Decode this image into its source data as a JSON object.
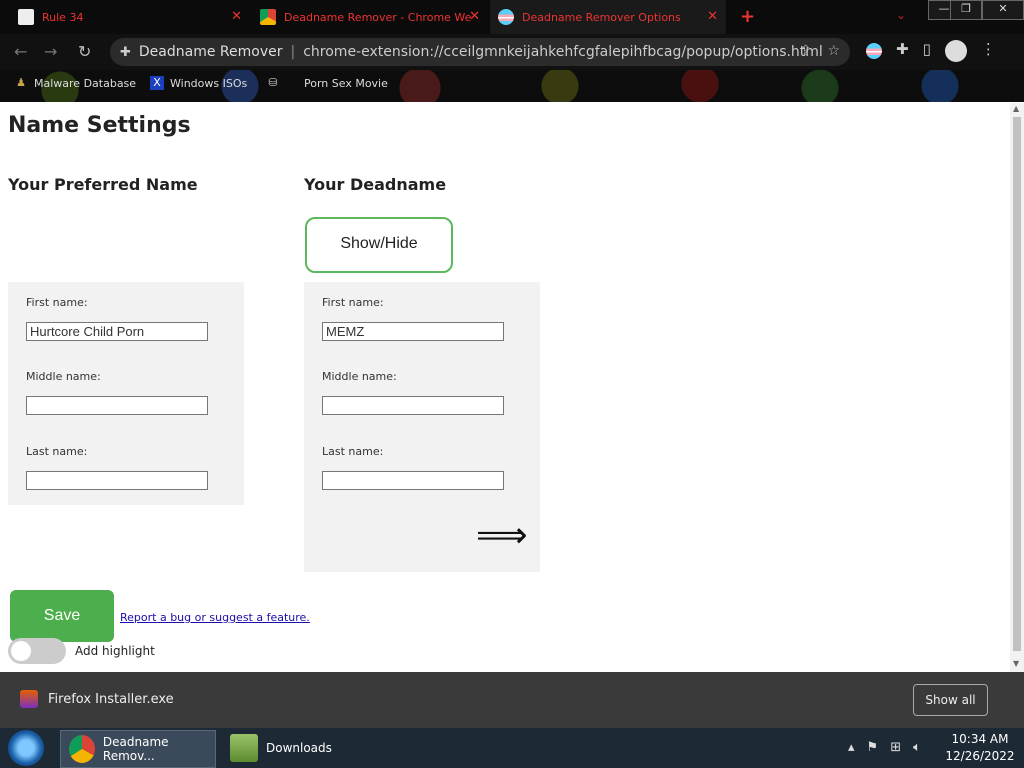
{
  "browser": {
    "tabs": [
      {
        "title": "Rule 34"
      },
      {
        "title": "Deadname Remover - Chrome We"
      },
      {
        "title": "Deadname Remover Options"
      }
    ],
    "omnibox": {
      "site_name": "Deadname Remover",
      "url": "chrome-extension://cceilgmnkeijahkehfcgfalepihfbcag/popup/options.html"
    },
    "bookmarks": [
      {
        "label": "Malware Database"
      },
      {
        "label": "Windows ISOs"
      },
      {
        "label": "Porn Sex Movie"
      }
    ],
    "colors": {
      "tab_text": "#e33333",
      "chrome_bg": "#0b0b0b"
    }
  },
  "page": {
    "title": "Name Settings",
    "preferred": {
      "heading": "Your Preferred Name",
      "first_label": "First name:",
      "first_value": "Hurtcore Child Porn",
      "middle_label": "Middle name:",
      "middle_value": "",
      "last_label": "Last name:",
      "last_value": ""
    },
    "deadname": {
      "heading": "Your Deadname",
      "toggle_button": "Show/Hide",
      "first_label": "First name:",
      "first_value": "MEMZ",
      "middle_label": "Middle name:",
      "middle_value": "",
      "last_label": "Last name:",
      "last_value": "",
      "arrow": "⟹"
    },
    "save_label": "Save",
    "report_link": "Report a bug or suggest a feature.",
    "highlight_label": "Add highlight",
    "colors": {
      "accent_green": "#4cae4c"
    }
  },
  "downloads": {
    "file": "Firefox Installer.exe",
    "show_all": "Show all"
  },
  "taskbar": {
    "items": [
      {
        "label": "Deadname Remov..."
      },
      {
        "label": "Downloads"
      }
    ],
    "time": "10:34 AM",
    "date": "12/26/2022"
  }
}
